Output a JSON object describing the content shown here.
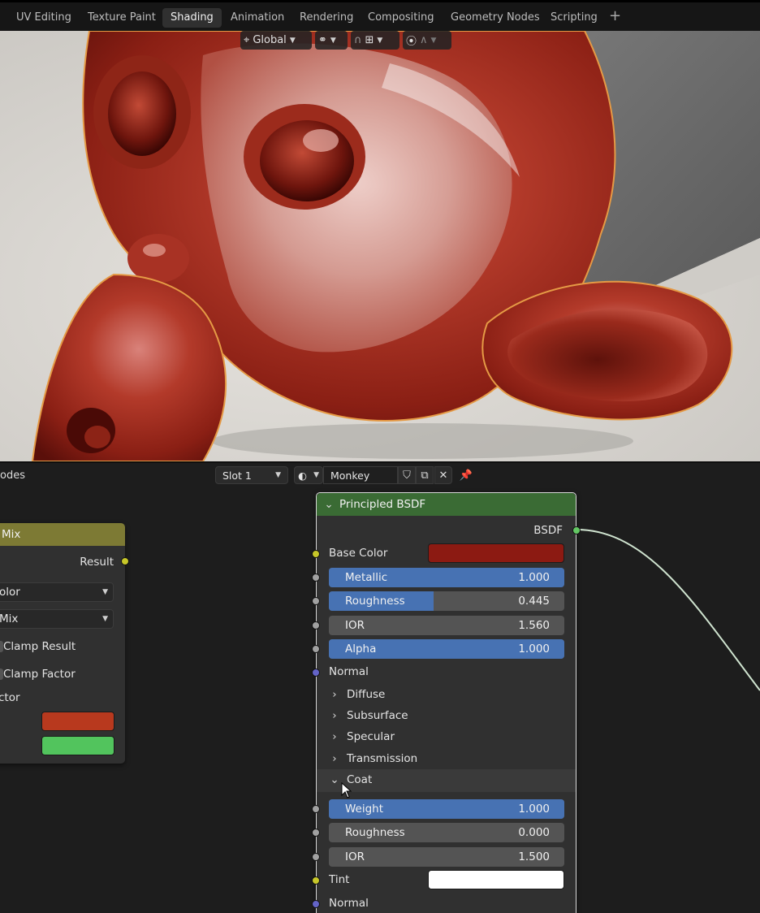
{
  "workspace_tabs": [
    "UV Editing",
    "Texture Paint",
    "Shading",
    "Animation",
    "Rendering",
    "Compositing",
    "Geometry Nodes",
    "Scripting"
  ],
  "active_tab": "Shading",
  "viewport_header": {
    "orientation": "Global"
  },
  "node_editor": {
    "header_label": "odes",
    "slot": "Slot 1",
    "material_name": "Monkey"
  },
  "mix_node": {
    "title": "Mix",
    "output": "Result",
    "data_type": "olor",
    "blend_mode": "Mix",
    "clamp_result": "Clamp Result",
    "clamp_factor": "Clamp Factor",
    "factor": "ctor",
    "colors": {
      "a": "#b8391e",
      "b": "#52c45d"
    }
  },
  "bsdf_node": {
    "title": "Principled BSDF",
    "output": "BSDF",
    "base_color_label": "Base Color",
    "base_color": "#8c1a12",
    "metallic": {
      "label": "Metallic",
      "value": "1.000",
      "fraction": 1.0
    },
    "roughness": {
      "label": "Roughness",
      "value": "0.445",
      "fraction": 0.445
    },
    "ior": {
      "label": "IOR",
      "value": "1.560",
      "fraction": 0.0
    },
    "alpha": {
      "label": "Alpha",
      "value": "1.000",
      "fraction": 1.0
    },
    "normal": "Normal",
    "panels": [
      "Diffuse",
      "Subsurface",
      "Specular",
      "Transmission"
    ],
    "coat": {
      "label": "Coat",
      "weight": {
        "label": "Weight",
        "value": "1.000",
        "fraction": 1.0
      },
      "roughness": {
        "label": "Roughness",
        "value": "0.000",
        "fraction": 0.0
      },
      "ior": {
        "label": "IOR",
        "value": "1.500",
        "fraction": 0.0
      },
      "tint_label": "Tint",
      "tint": "#ffffff",
      "normal": "Normal"
    }
  },
  "colors": {
    "bsdf_header": "#3a6b34",
    "mix_header": "#7d7a34",
    "slider_fill": "#4772b3",
    "link": "#cfe3cf"
  }
}
